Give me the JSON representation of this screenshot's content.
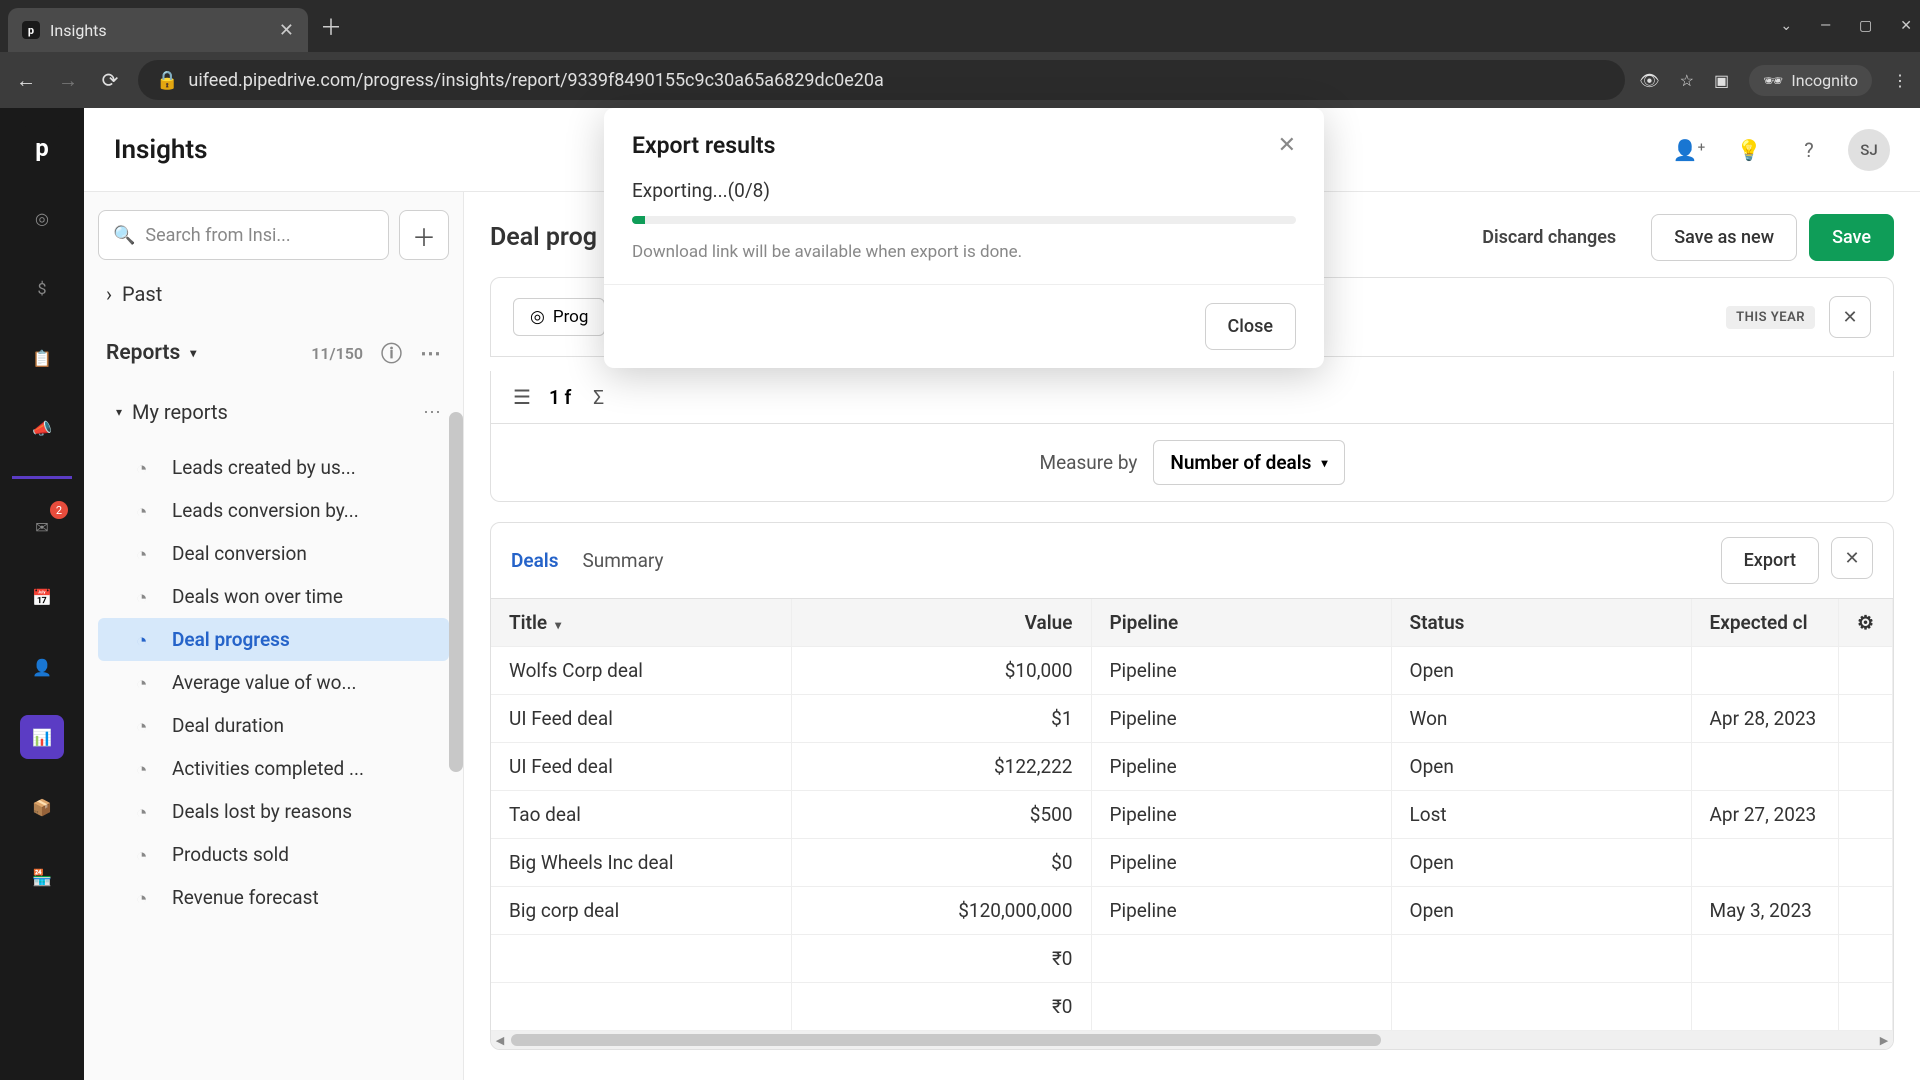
{
  "browser": {
    "tab_title": "Insights",
    "url": "uifeed.pipedrive.com/progress/insights/report/9339f8490155c9c30a65a6829dc0e20a",
    "incognito_label": "Incognito"
  },
  "rail": {
    "mail_badge": "2"
  },
  "page": {
    "title": "Insights",
    "avatar_initials": "SJ"
  },
  "sidebar": {
    "search_placeholder": "Search from Insi...",
    "past_label": "Past",
    "reports_label": "Reports",
    "reports_count": "11/150",
    "my_reports_label": "My reports",
    "items": [
      {
        "label": "Leads created by us..."
      },
      {
        "label": "Leads conversion by..."
      },
      {
        "label": "Deal conversion"
      },
      {
        "label": "Deals won over time"
      },
      {
        "label": "Deal progress"
      },
      {
        "label": "Average value of wo..."
      },
      {
        "label": "Deal duration"
      },
      {
        "label": "Activities completed ..."
      },
      {
        "label": "Deals lost by reasons"
      },
      {
        "label": "Products sold"
      },
      {
        "label": "Revenue forecast"
      }
    ]
  },
  "report": {
    "title": "Deal prog",
    "type_chip": "Prog",
    "filter_label": "1 f",
    "this_year": "THIS YEAR",
    "measure_by": "Measure by",
    "measure_value": "Number of deals",
    "discard": "Discard changes",
    "save_as_new": "Save as new",
    "save": "Save",
    "tab_deals": "Deals",
    "tab_summary": "Summary",
    "export": "Export",
    "columns": [
      "Title",
      "Value",
      "Pipeline",
      "Status",
      "Expected cl"
    ],
    "rows": [
      {
        "title": "Wolfs Corp deal",
        "value": "$10,000",
        "pipeline": "Pipeline",
        "status": "Open",
        "expected": ""
      },
      {
        "title": "UI Feed deal",
        "value": "$1",
        "pipeline": "Pipeline",
        "status": "Won",
        "expected": "Apr 28, 2023"
      },
      {
        "title": "UI Feed deal",
        "value": "$122,222",
        "pipeline": "Pipeline",
        "status": "Open",
        "expected": ""
      },
      {
        "title": "Tao deal",
        "value": "$500",
        "pipeline": "Pipeline",
        "status": "Lost",
        "expected": "Apr 27, 2023"
      },
      {
        "title": "Big Wheels Inc deal",
        "value": "$0",
        "pipeline": "Pipeline",
        "status": "Open",
        "expected": ""
      },
      {
        "title": "Big corp deal",
        "value": "$120,000,000",
        "pipeline": "Pipeline",
        "status": "Open",
        "expected": "May 3, 2023"
      },
      {
        "title": "",
        "value": "₹0",
        "pipeline": "",
        "status": "",
        "expected": ""
      },
      {
        "title": "",
        "value": "₹0",
        "pipeline": "",
        "status": "",
        "expected": ""
      }
    ]
  },
  "modal": {
    "title": "Export results",
    "status": "Exporting...(0/8)",
    "hint": "Download link will be available when export is done.",
    "close": "Close"
  }
}
